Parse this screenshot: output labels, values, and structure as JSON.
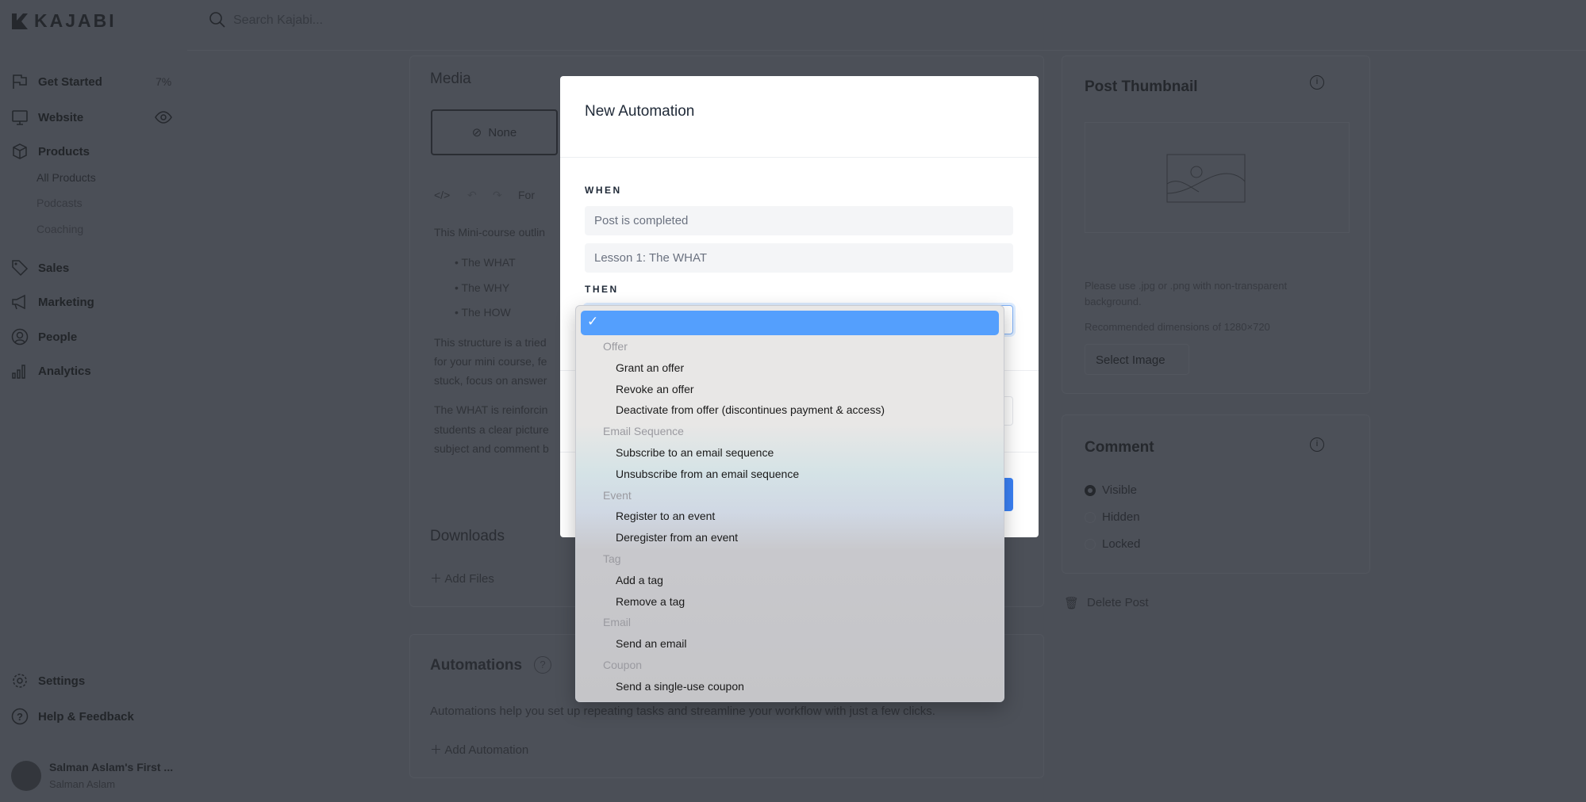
{
  "brand": "KAJABI",
  "search": {
    "placeholder": "Search Kajabi..."
  },
  "sidebar": {
    "items": [
      {
        "label": "Get Started",
        "badge": "7%"
      },
      {
        "label": "Website"
      },
      {
        "label": "Products",
        "children": [
          "All Products",
          "Podcasts",
          "Coaching"
        ]
      },
      {
        "label": "Sales"
      },
      {
        "label": "Marketing"
      },
      {
        "label": "People"
      },
      {
        "label": "Analytics"
      }
    ],
    "settings": "Settings",
    "help": "Help & Feedback",
    "user": {
      "site": "Salman Aslam's First ...",
      "name": "Salman Aslam"
    }
  },
  "main": {
    "media": {
      "title": "Media",
      "none": "None",
      "toolbar_format": "For"
    },
    "body": {
      "intro": "This Mini-course outlin",
      "bullets": [
        "The WHAT",
        "The WHY",
        "The HOW"
      ],
      "p1": [
        "This structure is a tried",
        "for your mini course, fe",
        "stuck, focus on answer"
      ],
      "p2": [
        "The WHAT is reinforcin",
        "students a clear picture",
        "subject and comment b"
      ]
    },
    "downloads": {
      "title": "Downloads",
      "add": "Add Files"
    },
    "automations": {
      "title": "Automations",
      "desc": "Automations help you set up repeating tasks and streamline your workflow with just a few clicks.",
      "add": "Add Automation"
    }
  },
  "right": {
    "thumbnail": {
      "title": "Post Thumbnail",
      "hint1": "Please use .jpg or .png with non-transparent",
      "hint2": "background.",
      "rec": "Recommended dimensions of 1280×720",
      "button": "Select Image"
    },
    "comment": {
      "title": "Comment",
      "options": [
        "Visible",
        "Hidden",
        "Locked"
      ],
      "selected": "Visible"
    },
    "delete": "Delete Post"
  },
  "modal": {
    "title": "New Automation",
    "when_label": "WHEN",
    "when_trigger": "Post is completed",
    "when_target": "Lesson 1: The WHAT",
    "then_label": "THEN"
  },
  "dropdown": {
    "selected_mark": "✓",
    "groups": [
      {
        "label": "Offer",
        "items": [
          "Grant an offer",
          "Revoke an offer",
          "Deactivate from offer (discontinues payment & access)"
        ]
      },
      {
        "label": "Email Sequence",
        "items": [
          "Subscribe to an email sequence",
          "Unsubscribe from an email sequence"
        ]
      },
      {
        "label": "Event",
        "items": [
          "Register to an event",
          "Deregister from an event"
        ]
      },
      {
        "label": "Tag",
        "items": [
          "Add a tag",
          "Remove a tag"
        ]
      },
      {
        "label": "Email",
        "items": [
          "Send an email"
        ]
      },
      {
        "label": "Coupon",
        "items": [
          "Send a single-use coupon"
        ]
      }
    ]
  },
  "colors": {
    "highlight": "#549ffd",
    "primary_button": "#3b82f6",
    "overlay": "#4b4f57"
  }
}
